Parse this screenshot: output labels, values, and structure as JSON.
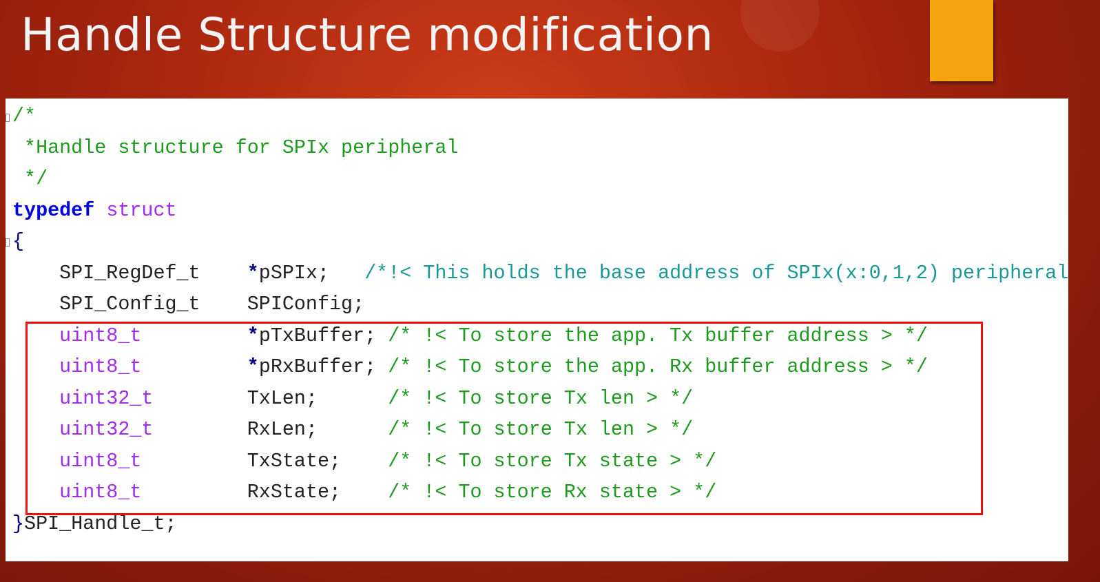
{
  "slide": {
    "title": "Handle Structure modification",
    "accent_color": "#f5a50e",
    "highlight_color": "#f00e0e"
  },
  "code": {
    "lines": [
      [
        {
          "t": "/*",
          "c": "cmt"
        }
      ],
      [
        {
          "t": " *Handle structure for SPIx peripheral",
          "c": "cmt"
        }
      ],
      [
        {
          "t": " */",
          "c": "cmt"
        }
      ],
      [
        {
          "t": "typedef",
          "c": "kw"
        },
        {
          "t": " ",
          "c": "plain"
        },
        {
          "t": "struct",
          "c": "typ"
        }
      ],
      [
        {
          "t": "{",
          "c": "brace"
        }
      ],
      [
        {
          "t": "    SPI_RegDef_t    ",
          "c": "plain"
        },
        {
          "t": "*",
          "c": "star"
        },
        {
          "t": "pSPIx;   ",
          "c": "plain"
        },
        {
          "t": "/*!< This holds the base address of SPIx(x:0,1,2) peripheral",
          "c": "doc"
        }
      ],
      [
        {
          "t": "    SPI_Config_t    SPIConfig;",
          "c": "plain"
        }
      ],
      [
        {
          "t": "    ",
          "c": "plain"
        },
        {
          "t": "uint8_t",
          "c": "typ"
        },
        {
          "t": "         ",
          "c": "plain"
        },
        {
          "t": "*",
          "c": "star"
        },
        {
          "t": "pTxBuffer; ",
          "c": "plain"
        },
        {
          "t": "/* !< To store the app. Tx buffer address > */",
          "c": "cmt"
        }
      ],
      [
        {
          "t": "    ",
          "c": "plain"
        },
        {
          "t": "uint8_t",
          "c": "typ"
        },
        {
          "t": "         ",
          "c": "plain"
        },
        {
          "t": "*",
          "c": "star"
        },
        {
          "t": "pRxBuffer; ",
          "c": "plain"
        },
        {
          "t": "/* !< To store the app. Rx buffer address > */",
          "c": "cmt"
        }
      ],
      [
        {
          "t": "    ",
          "c": "plain"
        },
        {
          "t": "uint32_t",
          "c": "typ"
        },
        {
          "t": "        TxLen;      ",
          "c": "plain"
        },
        {
          "t": "/* !< To store Tx len > */",
          "c": "cmt"
        }
      ],
      [
        {
          "t": "    ",
          "c": "plain"
        },
        {
          "t": "uint32_t",
          "c": "typ"
        },
        {
          "t": "        RxLen;      ",
          "c": "plain"
        },
        {
          "t": "/* !< To store Tx len > */",
          "c": "cmt"
        }
      ],
      [
        {
          "t": "    ",
          "c": "plain"
        },
        {
          "t": "uint8_t",
          "c": "typ"
        },
        {
          "t": "         TxState;    ",
          "c": "plain"
        },
        {
          "t": "/* !< To store Tx state > */",
          "c": "cmt"
        }
      ],
      [
        {
          "t": "    ",
          "c": "plain"
        },
        {
          "t": "uint8_t",
          "c": "typ"
        },
        {
          "t": "         RxState;    ",
          "c": "plain"
        },
        {
          "t": "/* !< To store Rx state > */",
          "c": "cmt"
        }
      ],
      [
        {
          "t": "}",
          "c": "brace"
        },
        {
          "t": "SPI_Handle_t;",
          "c": "plain"
        }
      ]
    ]
  }
}
